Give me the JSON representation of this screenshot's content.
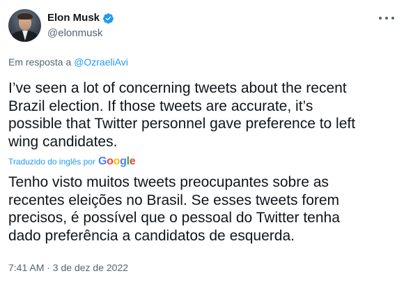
{
  "author": {
    "name": "Elon Musk",
    "handle": "@elonmusk",
    "verified": true
  },
  "reply": {
    "prefix": "Em resposta a",
    "to": "@OzraeliAvi"
  },
  "tweet": {
    "text": "I’ve seen a lot of concerning tweets about the recent\nBrazil election. If those tweets are accurate, it’s\npossible that Twitter personnel gave preference to left\nwing candidates.",
    "translated_label": "Traduzido do inglês por",
    "translator": "Google",
    "translated_text": "Tenho visto muitos tweets preocupantes sobre as\nrecentes eleições no Brasil. Se esses tweets forem\nprecisos, é possível que o pessoal do Twitter tenha\ndado preferência a candidatos de esquerda.",
    "timestamp": "7:41 AM · 3 de dez de 2022"
  },
  "colors": {
    "accent": "#1d9bf0",
    "text": "#0f1419",
    "secondary": "#536471"
  },
  "icons": {
    "verified": "verified-badge-icon",
    "more": "more-options-icon"
  }
}
